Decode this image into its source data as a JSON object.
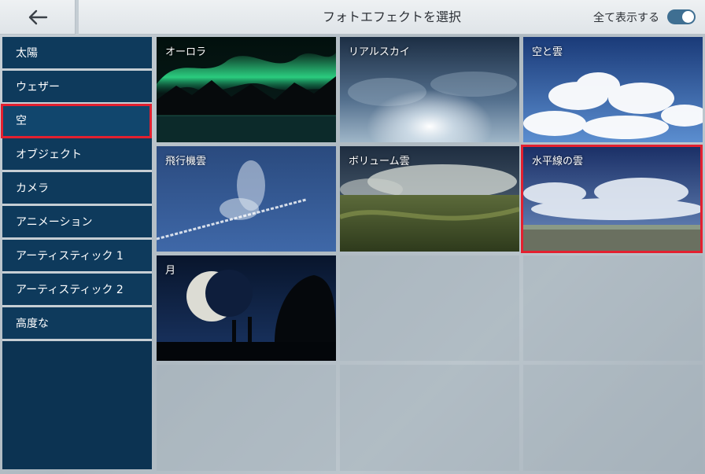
{
  "header": {
    "title": "フォトエフェクトを選択",
    "show_all_label": "全て表示する",
    "show_all_on": true
  },
  "sidebar": {
    "items": [
      {
        "label": "太陽"
      },
      {
        "label": "ウェザー"
      },
      {
        "label": "空",
        "selected": true
      },
      {
        "label": "オブジェクト"
      },
      {
        "label": "カメラ"
      },
      {
        "label": "アニメーション"
      },
      {
        "label": "アーティスティック 1"
      },
      {
        "label": "アーティスティック 2"
      },
      {
        "label": "高度な"
      }
    ]
  },
  "effects": [
    {
      "label": "オーロラ"
    },
    {
      "label": "リアルスカイ"
    },
    {
      "label": "空と雲"
    },
    {
      "label": "飛行機雲"
    },
    {
      "label": "ボリューム雲"
    },
    {
      "label": "水平線の雲",
      "selected": true
    },
    {
      "label": "月"
    }
  ],
  "colors": {
    "sidebar_bg": "#0e3a5c",
    "selection": "#e3202f",
    "toggle_on": "#3f6f92"
  }
}
